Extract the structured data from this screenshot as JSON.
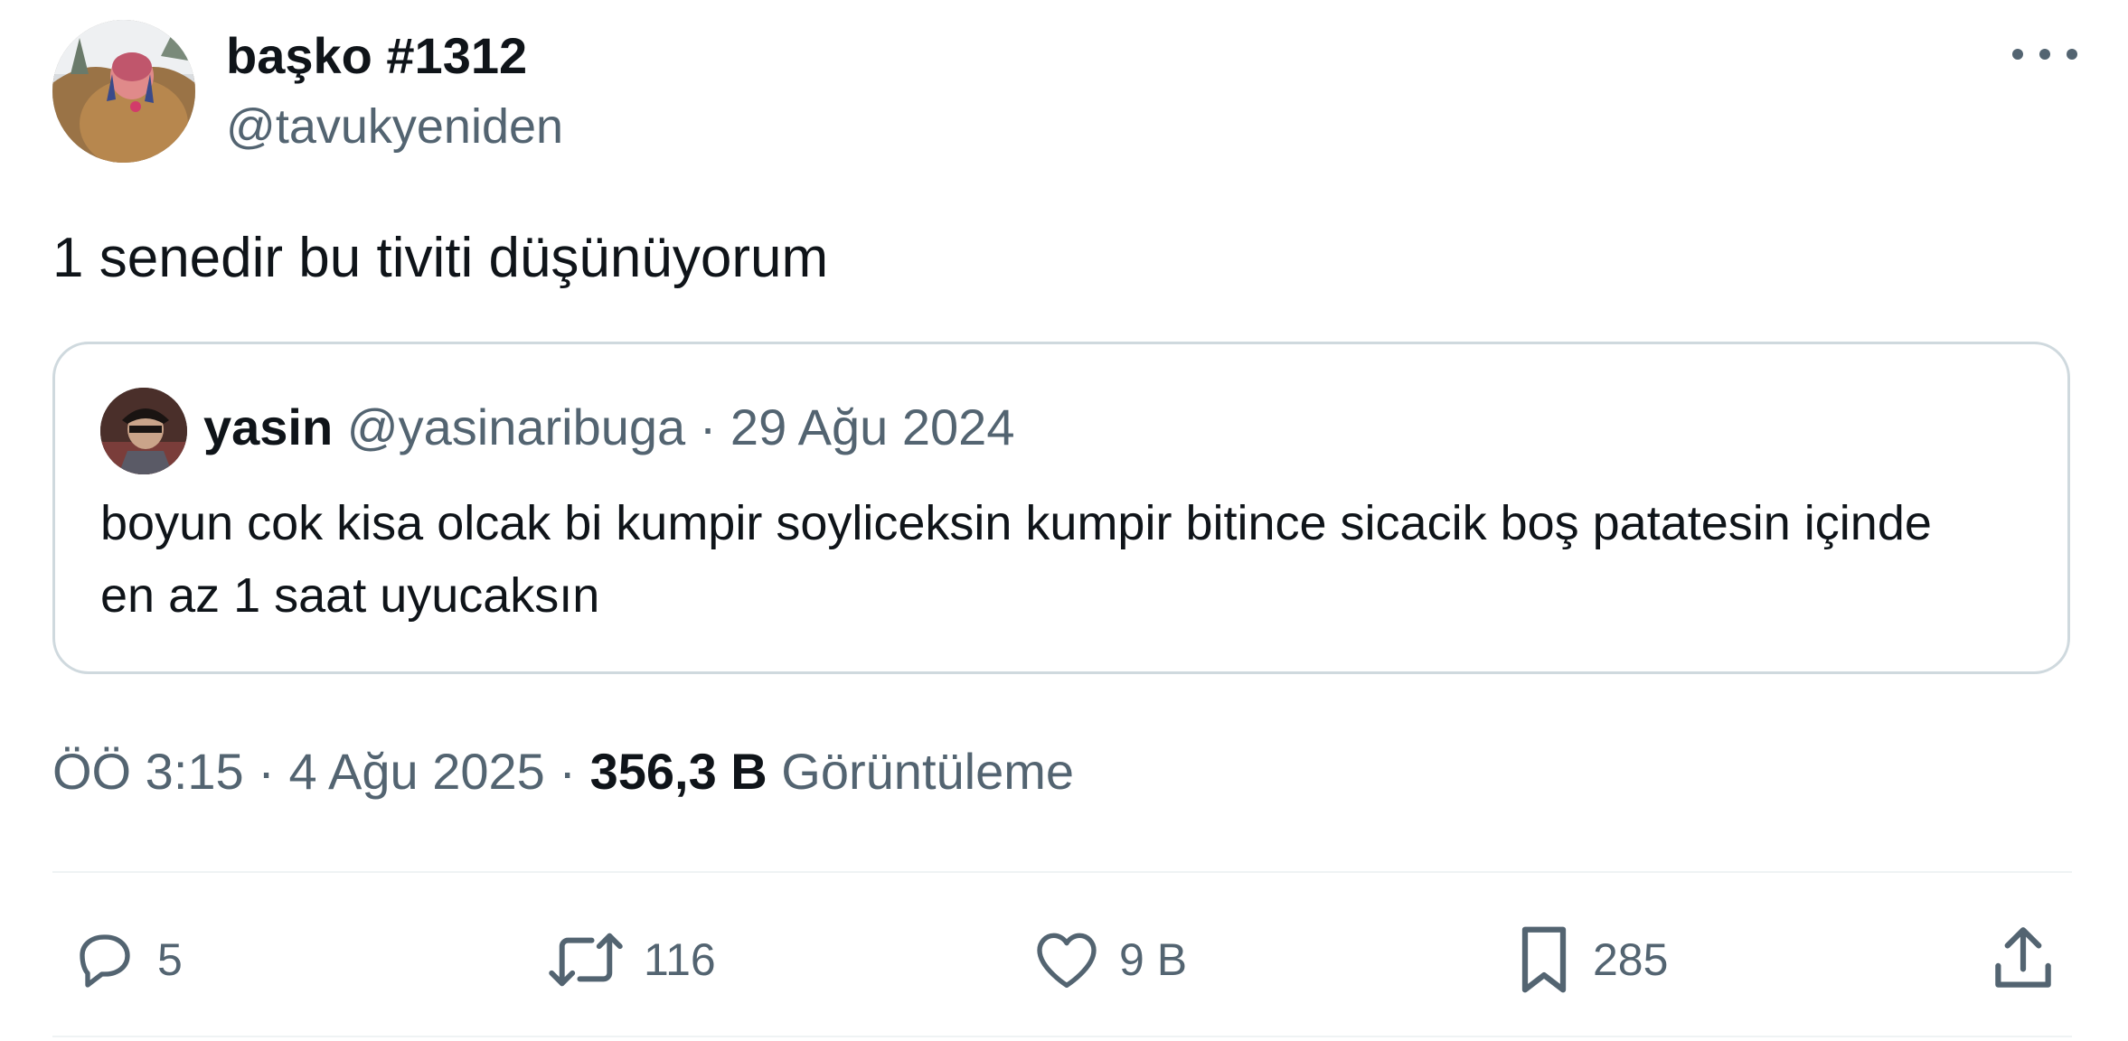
{
  "tweet": {
    "author": {
      "display_name": "başko #1312",
      "handle": "@tavukyeniden"
    },
    "text": "1 senedir bu tiviti düşünüyorum",
    "quoted_tweet": {
      "display_name": "yasin",
      "handle": "@yasinaribuga",
      "separator": " · ",
      "date": "29 Ağu 2024",
      "text": "boyun cok kisa olcak bi kumpir soyliceksin kumpir bitince sicacik boş patatesin içinde en az 1 saat uyucaksın"
    },
    "meta": {
      "time": "ÖÖ 3:15",
      "separator": " · ",
      "date": "4 Ağu 2025",
      "views_count": "356,3 B",
      "views_label": "Görüntüleme"
    },
    "actions": {
      "replies": "5",
      "retweets": "116",
      "likes": "9 B",
      "bookmarks": "285"
    }
  },
  "icons": {
    "more": "more-dots-icon",
    "reply": "reply-icon",
    "retweet": "retweet-icon",
    "like": "heart-icon",
    "bookmark": "bookmark-icon",
    "share": "share-icon"
  },
  "colors": {
    "text_primary": "#0f1419",
    "text_secondary": "#536471",
    "border": "#cfd9de",
    "divider": "#eff3f4"
  }
}
